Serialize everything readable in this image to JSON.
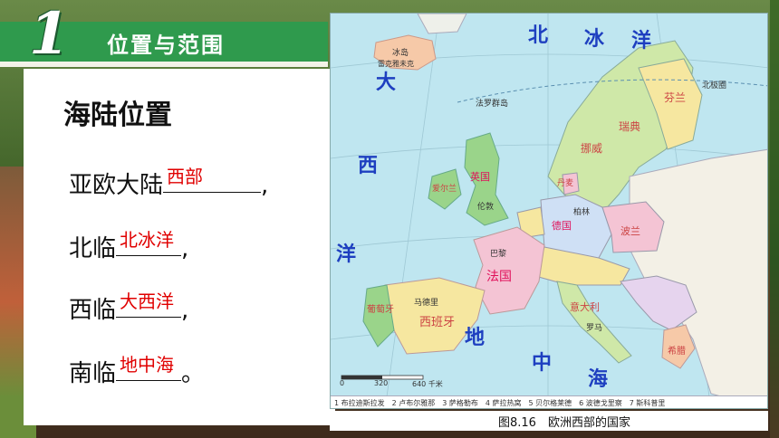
{
  "section": {
    "number": "1",
    "title": "位置与范围"
  },
  "content": {
    "heading": "海陆位置",
    "lines": [
      {
        "prefix": "亚欧大陆",
        "answer": "西部",
        "suffix": ","
      },
      {
        "prefix": "北临",
        "answer": "北冰洋",
        "suffix": ","
      },
      {
        "prefix": "西临",
        "answer": "大西洋",
        "suffix": ","
      },
      {
        "prefix": "南临",
        "answer": "地中海",
        "suffix": "。"
      }
    ]
  },
  "map": {
    "caption": "图8.16　欧洲西部的国家",
    "ocean_labels": [
      "北",
      "冰",
      "洋",
      "大",
      "西",
      "洋",
      "地",
      "中",
      "海"
    ],
    "scale_labels": [
      "0",
      "320",
      "640 千米"
    ],
    "legend": "1 布拉迪斯拉发　2 卢布尔雅那　3 萨格勒布　4 萨拉热窝　5 贝尔格莱德　6 波德戈里察　7 斯科普里",
    "place_labels": [
      "冰岛",
      "雷克雅未克",
      "法罗群岛",
      "英国",
      "爱尔兰",
      "伦敦",
      "法国",
      "巴黎",
      "西班牙",
      "葡萄牙",
      "马德里",
      "德国",
      "柏林",
      "挪威",
      "瑞典",
      "芬兰",
      "丹麦",
      "波兰",
      "意大利",
      "罗马",
      "希腊",
      "北极圈"
    ],
    "colors": {
      "sea": "#bfe6f0",
      "land": "#f3f0e6",
      "scandinavia": "#cfe8a8",
      "uk": "#9ad48a",
      "france": "#f4c4d4",
      "iberia": "#f6e7a0"
    }
  }
}
